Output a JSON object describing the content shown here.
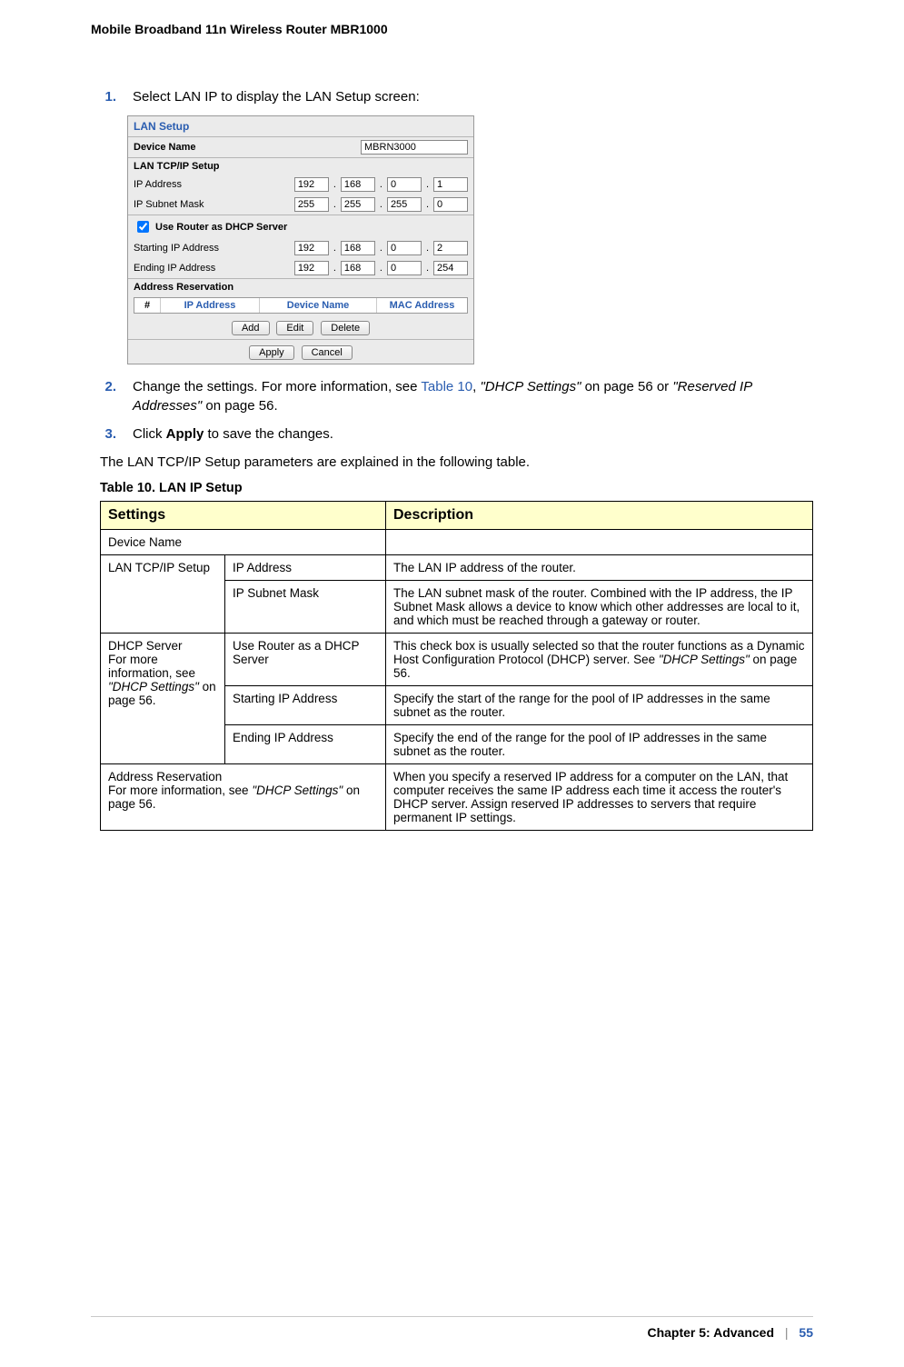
{
  "header": {
    "product": "Mobile Broadband 11n Wireless Router MBR1000"
  },
  "steps": {
    "s1": {
      "num": "1.",
      "text": "Select LAN IP to display the LAN Setup screen:"
    },
    "s2": {
      "num": "2.",
      "prefix": "Change the settings. For more information, see ",
      "link": "Table 10",
      "mid1": ", ",
      "italic1": "\"DHCP Settings\"",
      "mid2": " on page 56 or ",
      "italic2": "\"Reserved IP Addresses\"",
      "tail": " on page 56."
    },
    "s3": {
      "num": "3.",
      "prefix": "Click ",
      "bold": "Apply",
      "tail": " to save the changes."
    }
  },
  "panel": {
    "title": "LAN Setup",
    "device_name_label": "Device Name",
    "device_name_value": "MBRN3000",
    "lan_tcpip_label": "LAN TCP/IP Setup",
    "ip_address_label": "IP Address",
    "ip_address": [
      "192",
      "168",
      "0",
      "1"
    ],
    "subnet_label": "IP Subnet Mask",
    "subnet": [
      "255",
      "255",
      "255",
      "0"
    ],
    "dhcp_check_label": "Use Router as DHCP Server",
    "start_ip_label": "Starting IP Address",
    "start_ip": [
      "192",
      "168",
      "0",
      "2"
    ],
    "end_ip_label": "Ending IP Address",
    "end_ip": [
      "192",
      "168",
      "0",
      "254"
    ],
    "addr_res_label": "Address Reservation",
    "tbl": {
      "c0": "#",
      "c1": "IP Address",
      "c2": "Device Name",
      "c3": "MAC Address"
    },
    "btns": {
      "add": "Add",
      "edit": "Edit",
      "del": "Delete",
      "apply": "Apply",
      "cancel": "Cancel"
    }
  },
  "paragraph": "The LAN TCP/IP Setup parameters are explained in the following table.",
  "tableCaption": "Table 10.  LAN IP Setup",
  "table": {
    "headers": {
      "settings": "Settings",
      "description": "Description"
    },
    "r1": {
      "c1": "Device Name",
      "c2": ""
    },
    "r2": {
      "group": "LAN TCP/IP Setup",
      "a": {
        "s": "IP Address",
        "d": "The LAN IP address of the router."
      },
      "b": {
        "s": "IP Subnet Mask",
        "d": "The LAN subnet mask of the router. Combined with the IP address, the IP Subnet Mask allows a device to know which other addresses are local to it, and which must be reached through a gateway or router."
      }
    },
    "r3": {
      "group_l1": "DHCP Server",
      "group_l2a": "For more information, see ",
      "group_l2_it": "\"DHCP Settings\"",
      "group_l2b": " on page 56.",
      "a": {
        "s": "Use Router as a DHCP Server",
        "d_pre": "This check box is usually selected so that the router functions as a Dynamic Host Configuration Protocol (DHCP) server. See ",
        "d_it": "\"DHCP Settings\"",
        "d_post": " on page 56."
      },
      "b": {
        "s": "Starting IP Address",
        "d": "Specify the start of the range for the pool of IP addresses in the same subnet as the router."
      },
      "c": {
        "s": "Ending IP Address",
        "d": "Specify the end of the range for the pool of IP addresses in the same subnet as the router."
      }
    },
    "r4": {
      "s_l1": "Address Reservation",
      "s_l2a": "For more information, see ",
      "s_l2_it": "\"DHCP Settings\"",
      "s_l2b": " on page 56.",
      "d": "When you specify a reserved IP address for a computer on the LAN, that computer receives the same IP address each time it access the router's DHCP server. Assign reserved IP addresses to servers that require permanent IP settings."
    }
  },
  "footer": {
    "chapter": "Chapter 5:  Advanced",
    "divider": "|",
    "page": "55"
  }
}
